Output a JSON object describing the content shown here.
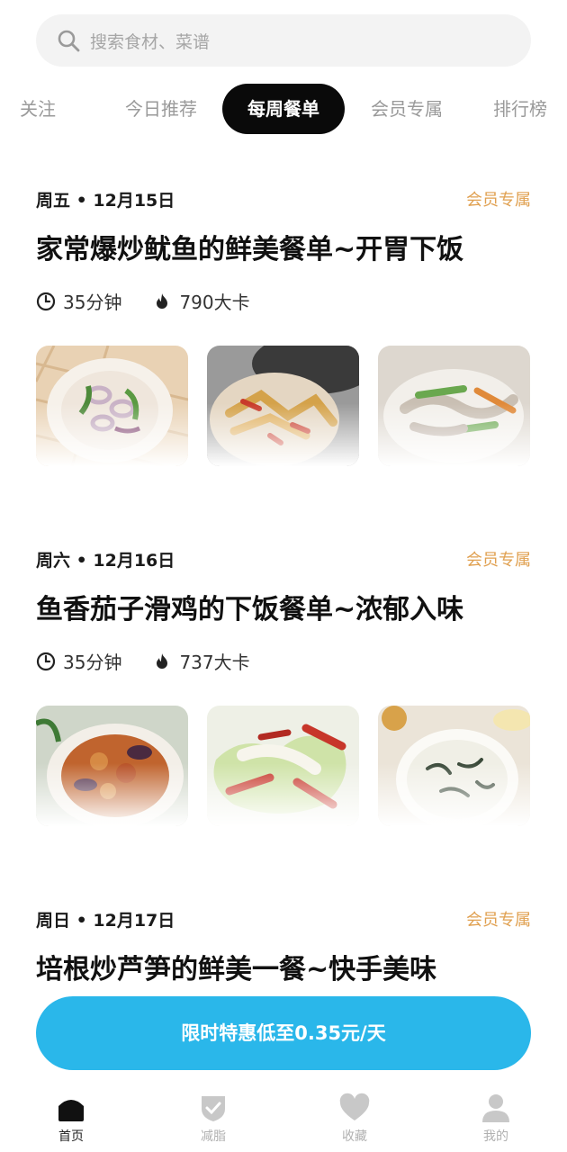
{
  "search": {
    "placeholder": "搜索食材、菜谱"
  },
  "tabs": [
    "关注",
    "今日推荐",
    "每周餐单",
    "会员专属",
    "排行榜"
  ],
  "active_tab": "每周餐单",
  "menus": [
    {
      "date": "周五 • 12月15日",
      "badge": "会员专属",
      "title": "家常爆炒鱿鱼的鲜美餐单~开胃下饭",
      "time": "35分钟",
      "calories": "790大卡",
      "dishes": [
        "squid-stirfry-icon",
        "spicy-stirfry-icon",
        "squid-pepper-icon"
      ]
    },
    {
      "date": "周六 • 12月16日",
      "badge": "会员专属",
      "title": "鱼香茄子滑鸡的下饭餐单~浓郁入味",
      "time": "35分钟",
      "calories": "737大卡",
      "dishes": [
        "eggplant-chicken-icon",
        "cabbage-chili-icon",
        "seaweed-egg-soup-icon"
      ]
    },
    {
      "date": "周日 • 12月17日",
      "badge": "会员专属",
      "title": "培根炒芦笋的鲜美一餐~快手美味"
    }
  ],
  "promo": {
    "label": "限时特惠低至0.35元/天"
  },
  "nav": [
    {
      "label": "首页",
      "icon": "home-icon"
    },
    {
      "label": "减脂",
      "icon": "shield-check-icon"
    },
    {
      "label": "收藏",
      "icon": "heart-icon"
    },
    {
      "label": "我的",
      "icon": "user-icon"
    }
  ],
  "colors": {
    "accent": "#2ab7ea",
    "badge": "#e0a050",
    "active_tab_bg": "#0a0a0a"
  }
}
